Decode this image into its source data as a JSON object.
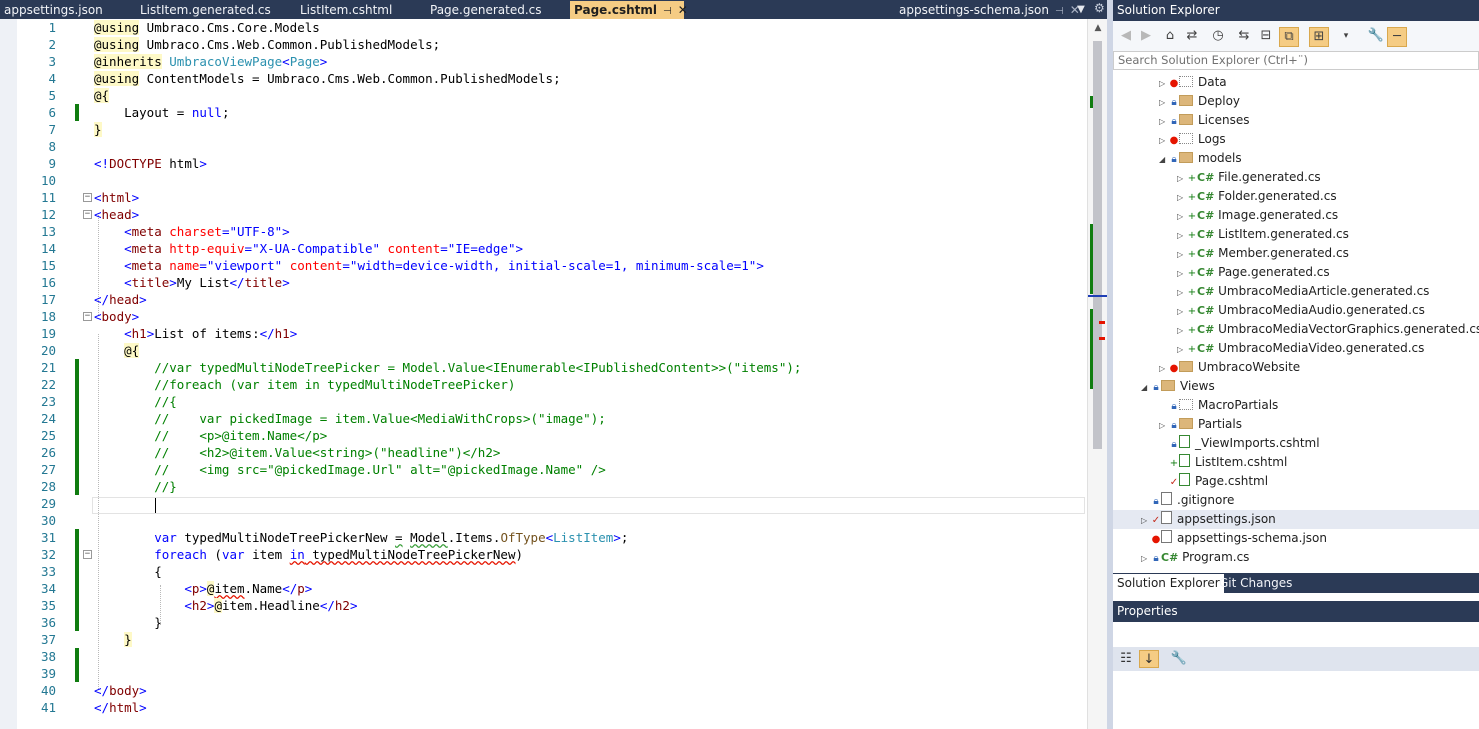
{
  "tabs": [
    {
      "label": "appsettings.json"
    },
    {
      "label": "ListItem.generated.cs"
    },
    {
      "label": "ListItem.cshtml"
    },
    {
      "label": "Page.generated.cs"
    },
    {
      "label": "Page.cshtml",
      "active": true
    },
    {
      "label": "appsettings-schema.json"
    }
  ],
  "editor": {
    "lines": [
      "1",
      "2",
      "3",
      "4",
      "5",
      "6",
      "7",
      "8",
      "9",
      "10",
      "11",
      "12",
      "13",
      "14",
      "15",
      "16",
      "17",
      "18",
      "19",
      "20",
      "21",
      "22",
      "23",
      "24",
      "25",
      "26",
      "27",
      "28",
      "29",
      "30",
      "31",
      "32",
      "33",
      "34",
      "35",
      "36",
      "37",
      "38",
      "39",
      "40",
      "41"
    ]
  },
  "solution_explorer": {
    "title": "Solution Explorer",
    "search_placeholder": "Search Solution Explorer (Ctrl+¨)",
    "items": [
      {
        "label": "Data"
      },
      {
        "label": "Deploy"
      },
      {
        "label": "Licenses"
      },
      {
        "label": "Logs"
      },
      {
        "label": "models"
      },
      {
        "label": "File.generated.cs"
      },
      {
        "label": "Folder.generated.cs"
      },
      {
        "label": "Image.generated.cs"
      },
      {
        "label": "ListItem.generated.cs"
      },
      {
        "label": "Member.generated.cs"
      },
      {
        "label": "Page.generated.cs"
      },
      {
        "label": "UmbracoMediaArticle.generated.cs"
      },
      {
        "label": "UmbracoMediaAudio.generated.cs"
      },
      {
        "label": "UmbracoMediaVectorGraphics.generated.cs"
      },
      {
        "label": "UmbracoMediaVideo.generated.cs"
      },
      {
        "label": "UmbracoWebsite"
      },
      {
        "label": "Views"
      },
      {
        "label": "MacroPartials"
      },
      {
        "label": "Partials"
      },
      {
        "label": "_ViewImports.cshtml"
      },
      {
        "label": "ListItem.cshtml"
      },
      {
        "label": "Page.cshtml"
      },
      {
        "label": ".gitignore"
      },
      {
        "label": "appsettings.json"
      },
      {
        "label": "appsettings-schema.json"
      },
      {
        "label": "Program.cs"
      }
    ],
    "bottom_tabs": [
      {
        "label": "Solution Explorer",
        "active": true
      },
      {
        "label": "Git Changes"
      }
    ]
  },
  "properties": {
    "title": "Properties"
  },
  "icons": [
    "back-icon",
    "forward-icon",
    "home-icon",
    "switch-views-icon",
    "history-icon",
    "sync-icon",
    "collapse-all-icon",
    "show-all-files-icon",
    "preview-icon",
    "properties-wrench-icon",
    "pin-icon",
    "close-icon",
    "categorized-icon",
    "alphabetical-icon"
  ]
}
